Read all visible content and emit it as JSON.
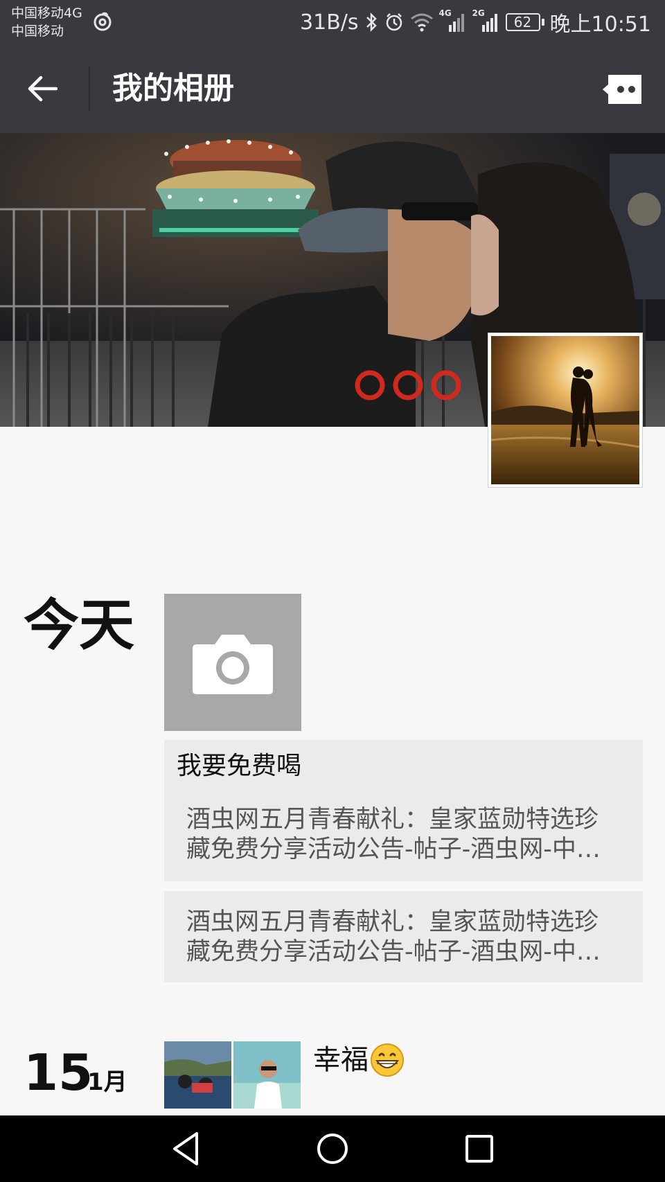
{
  "status_bar": {
    "carrier_line1": "中国移动4G",
    "carrier_line2": "中国移动",
    "speed": "31B/s",
    "signal_4g": "4G",
    "signal_2g": "2G",
    "battery": "62",
    "time": "晚上10:51"
  },
  "header": {
    "title": "我的相册"
  },
  "timeline": {
    "today_label": "今天",
    "share_card_1": {
      "title": "我要免费喝",
      "desc": "酒虫网五月青春献礼：皇家蓝勋特选珍\n藏免费分享活动公告-帖子-酒虫网-中…"
    },
    "share_card_2": {
      "desc": "酒虫网五月青春献礼：皇家蓝勋特选珍\n藏免费分享活动公告-帖子-酒虫网-中…"
    },
    "entry_2": {
      "day": "15",
      "month": "1月",
      "text": "幸福"
    }
  },
  "colors": {
    "header_bg": "#393a3f",
    "page_bg": "#f7f7f7",
    "card_bg": "#ebebeb",
    "camera_tile_bg": "#a8a8a8"
  },
  "icons": {
    "back": "arrow-left-icon",
    "more": "more-chat-icon",
    "camera": "camera-icon",
    "emoji": "grinning-face-emoji"
  }
}
